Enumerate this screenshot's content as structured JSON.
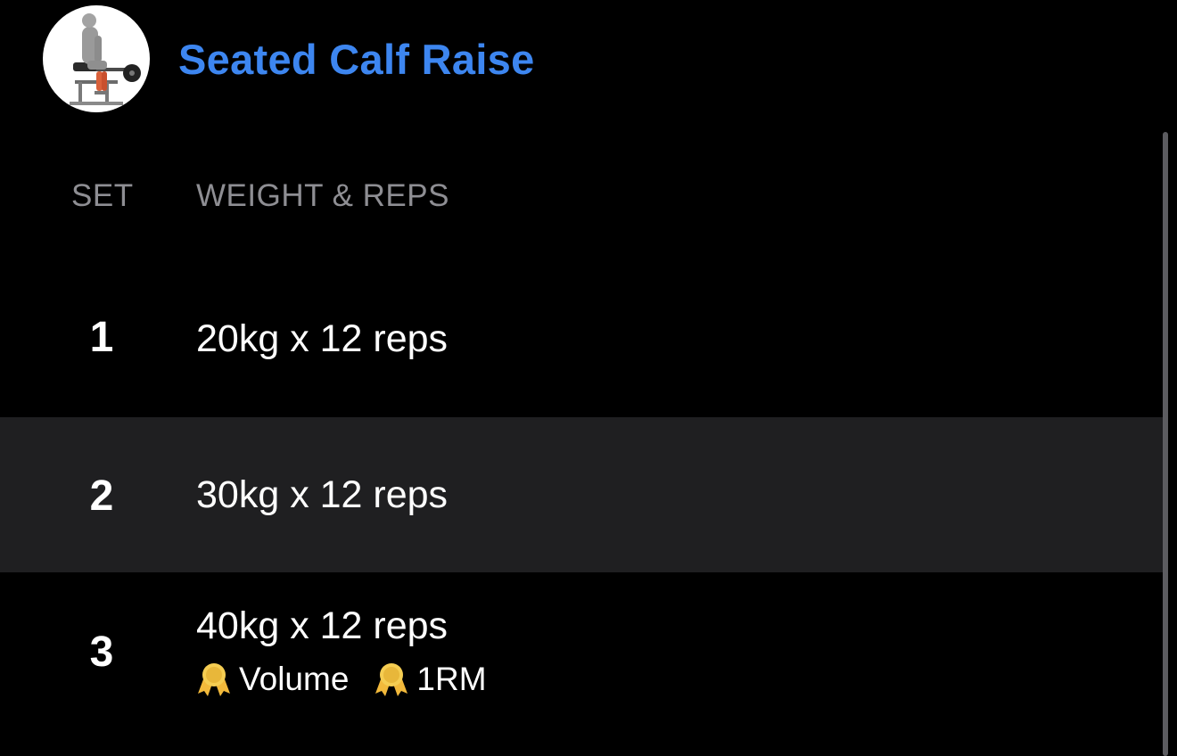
{
  "exercise": {
    "title": "Seated Calf Raise",
    "thumbnail_icon": "seated-calf-raise-illustration"
  },
  "columns": {
    "set": "SET",
    "weight_reps": "WEIGHT & REPS"
  },
  "sets": [
    {
      "number": "1",
      "value": "20kg x 12 reps"
    },
    {
      "number": "2",
      "value": "30kg x 12 reps"
    },
    {
      "number": "3",
      "value": "40kg x 12 reps",
      "records": [
        {
          "icon": "medal-icon",
          "label": "Volume"
        },
        {
          "icon": "medal-icon",
          "label": "1RM"
        }
      ]
    }
  ],
  "colors": {
    "accent": "#3d86f0",
    "background": "#000000",
    "row_highlight": "#1f1f21",
    "header_text": "#8e8e93",
    "medal": "#f2c94c"
  }
}
